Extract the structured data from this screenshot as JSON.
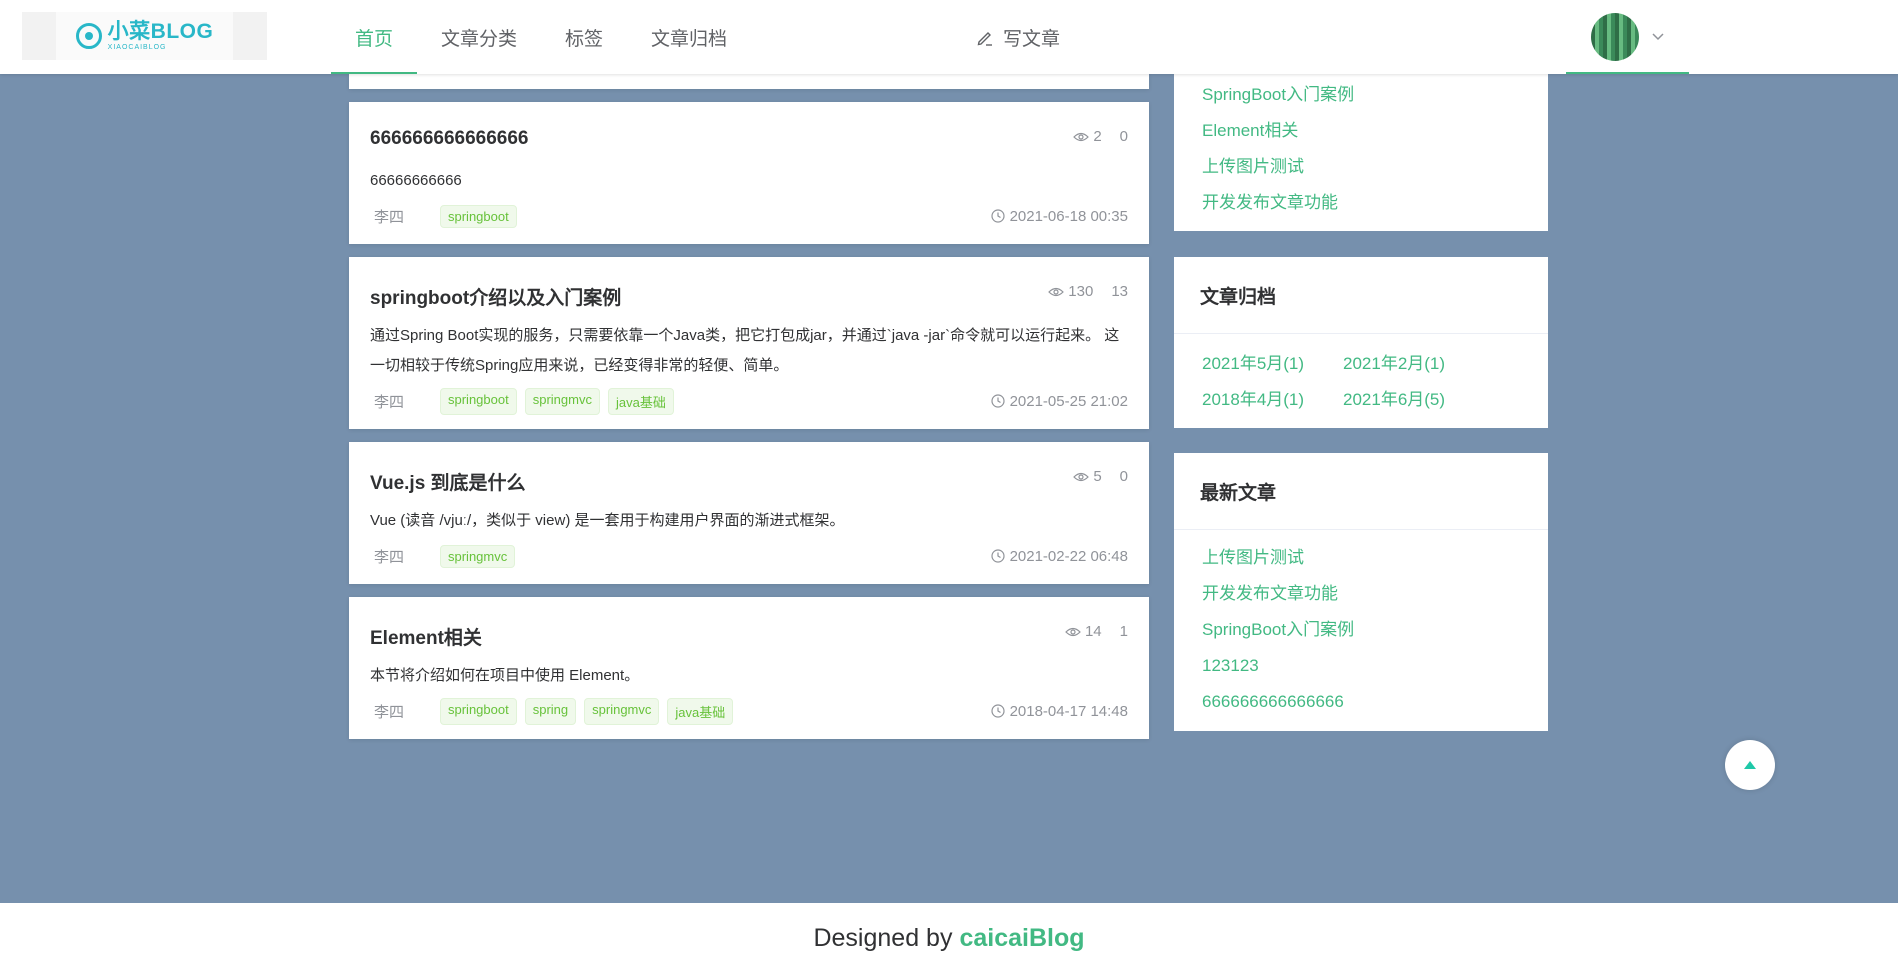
{
  "header": {
    "logo": {
      "text": "小菜BLOG",
      "sub": "XIAOCAIBLOG"
    },
    "nav": [
      {
        "label": "首页",
        "active": true
      },
      {
        "label": "文章分类",
        "active": false
      },
      {
        "label": "标签",
        "active": false
      },
      {
        "label": "文章归档",
        "active": false
      }
    ],
    "write_label": "写文章"
  },
  "articles": [
    {
      "title": "666666666666666",
      "summary": "66666666666",
      "views": "2",
      "comments": "0",
      "author": "李四",
      "tags": [
        "springboot"
      ],
      "date": "2021-06-18 00:35"
    },
    {
      "title": "springboot介绍以及入门案例",
      "summary": "通过Spring Boot实现的服务，只需要依靠一个Java类，把它打包成jar，并通过`java -jar`命令就可以运行起来。 这一切相较于传统Spring应用来说，已经变得非常的轻便、简单。",
      "views": "130",
      "comments": "13",
      "author": "李四",
      "tags": [
        "springboot",
        "springmvc",
        "java基础"
      ],
      "date": "2021-05-25 21:02"
    },
    {
      "title": "Vue.js 到底是什么",
      "summary": "Vue (读音 /vjuː/，类似于 view) 是一套用于构建用户界面的渐进式框架。",
      "views": "5",
      "comments": "0",
      "author": "李四",
      "tags": [
        "springmvc"
      ],
      "date": "2021-02-22 06:48"
    },
    {
      "title": "Element相关",
      "summary": "本节将介绍如何在项目中使用 Element。",
      "views": "14",
      "comments": "1",
      "author": "李四",
      "tags": [
        "springboot",
        "spring",
        "springmvc",
        "java基础"
      ],
      "date": "2018-04-17 14:48"
    }
  ],
  "sidebar": {
    "hot_partial": [
      "SpringBoot入门案例",
      "Element相关",
      "上传图片测试",
      "开发发布文章功能"
    ],
    "archive": {
      "title": "文章归档",
      "items": [
        "2021年5月(1)",
        "2021年2月(1)",
        "2018年4月(1)",
        "2021年6月(5)"
      ]
    },
    "latest": {
      "title": "最新文章",
      "items": [
        "上传图片测试",
        "开发发布文章功能",
        "SpringBoot入门案例",
        "123123",
        "666666666666666"
      ]
    }
  },
  "footer": {
    "prefix": "Designed by",
    "brand": "caicaiBlog"
  },
  "colors": {
    "accent": "#42b983",
    "background": "#7690ad",
    "tag": "#67c23a"
  }
}
